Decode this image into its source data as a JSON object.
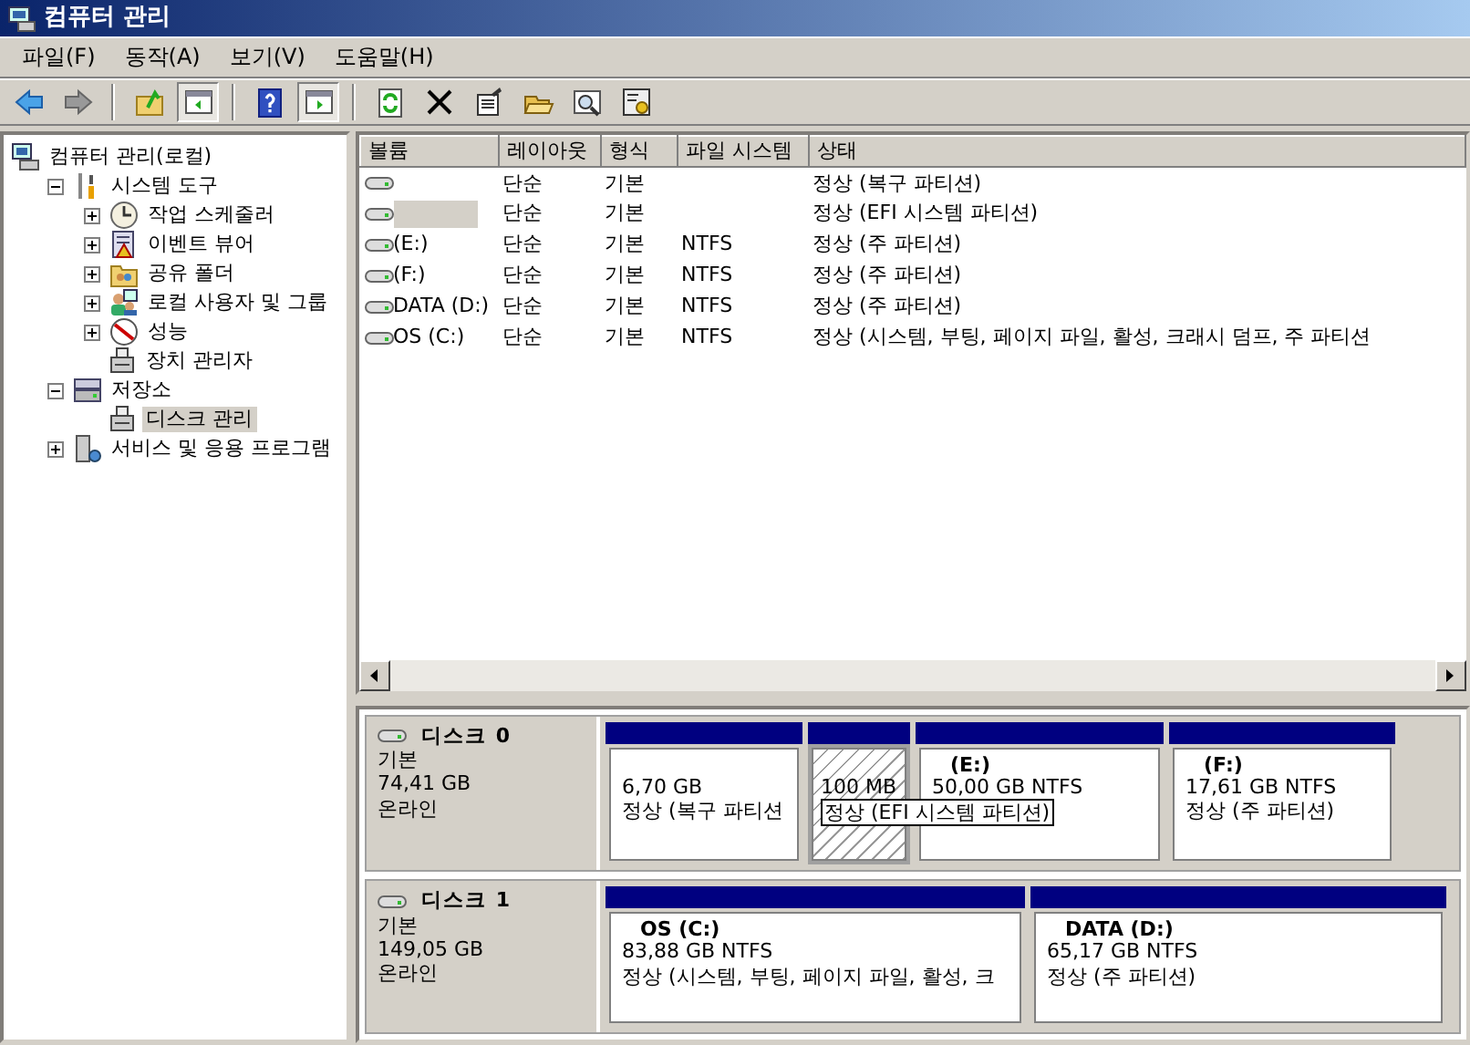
{
  "window": {
    "title": "컴퓨터 관리"
  },
  "menu": [
    "파일(F)",
    "동작(A)",
    "보기(V)",
    "도움말(H)"
  ],
  "toolbar": [
    {
      "kind": "back",
      "pressed": false
    },
    {
      "kind": "forward",
      "pressed": false
    },
    {
      "kind": "sep"
    },
    {
      "kind": "up",
      "pressed": false
    },
    {
      "kind": "pane",
      "pressed": true
    },
    {
      "kind": "sep"
    },
    {
      "kind": "help",
      "pressed": false
    },
    {
      "kind": "pane2",
      "pressed": true
    },
    {
      "kind": "sep"
    },
    {
      "kind": "refresh",
      "pressed": false
    },
    {
      "kind": "delete",
      "pressed": false
    },
    {
      "kind": "props",
      "pressed": false
    },
    {
      "kind": "open",
      "pressed": false
    },
    {
      "kind": "search",
      "pressed": false
    },
    {
      "kind": "config",
      "pressed": false
    }
  ],
  "tree": [
    {
      "label": "컴퓨터 관리(로컬)",
      "selected": false,
      "children": [
        {
          "label": "시스템 도구",
          "expanded": true,
          "selected": false,
          "children": [
            {
              "label": "작업 스케줄러",
              "expanded": false,
              "selected": false
            },
            {
              "label": "이벤트 뷰어",
              "expanded": false,
              "selected": false
            },
            {
              "label": "공유 폴더",
              "expanded": false,
              "selected": false
            },
            {
              "label": "로컬 사용자 및 그룹",
              "expanded": false,
              "selected": false
            },
            {
              "label": "성능",
              "expanded": false,
              "selected": false
            },
            {
              "label": "장치 관리자",
              "selected": false
            }
          ]
        },
        {
          "label": "저장소",
          "expanded": true,
          "selected": false,
          "children": [
            {
              "label": "디스크 관리",
              "selected": true
            }
          ]
        },
        {
          "label": "서비스 및 응용 프로그램",
          "expanded": false,
          "selected": false
        }
      ]
    }
  ],
  "table": {
    "columns": [
      "볼륨",
      "레이아웃",
      "형식",
      "파일 시스템",
      "상태"
    ],
    "rows": [
      {
        "redacted": false,
        "layout": "단순",
        "type": "기본",
        "status": "정상 (복구 파티션)"
      },
      {
        "redacted": true,
        "layout": "단순",
        "type": "기본",
        "status": "정상 (EFI 시스템 파티션)"
      },
      {
        "volume": " (E:)",
        "redacted": false,
        "layout": "단순",
        "type": "기본",
        "fs": "NTFS",
        "status": "정상 (주 파티션)"
      },
      {
        "volume": " (F:)",
        "redacted": false,
        "layout": "단순",
        "type": "기본",
        "fs": "NTFS",
        "status": "정상 (주 파티션)"
      },
      {
        "volume": "DATA (D:)",
        "redacted": false,
        "layout": "단순",
        "type": "기본",
        "fs": "NTFS",
        "status": "정상 (주 파티션)"
      },
      {
        "volume": "OS (C:)",
        "redacted": false,
        "layout": "단순",
        "type": "기본",
        "fs": "NTFS",
        "status": "정상 (시스템, 부팅, 페이지 파일, 활성, 크래시 덤프, 주 파티션"
      }
    ]
  },
  "disks": [
    {
      "name": "디스크 0",
      "type": "기본",
      "size": "74,41 GB",
      "state": "온라인",
      "partitions": [
        {
          "size": "6,70 GB",
          "status": "정상 (복구 파티션",
          "selected": false
        },
        {
          "size": "100 MB",
          "status": "정상 (EFI 시스템 파티션)",
          "selected": true
        },
        {
          "label": "(E:)",
          "size": "50,00 GB NTFS",
          "selected": false
        },
        {
          "label": "(F:)",
          "size": "17,61 GB NTFS",
          "status": "정상 (주 파티션)",
          "selected": false
        }
      ]
    },
    {
      "name": "디스크 1",
      "type": "기본",
      "size": "149,05 GB",
      "state": "온라인",
      "partitions": [
        {
          "label": "OS  (C:)",
          "size": "83,88 GB NTFS",
          "status": "정상 (시스템, 부팅, 페이지 파일, 활성, 크",
          "selected": false
        },
        {
          "label": "DATA  (D:)",
          "size": "65,17 GB NTFS",
          "status": "정상 (주 파티션)",
          "selected": false
        }
      ]
    }
  ]
}
